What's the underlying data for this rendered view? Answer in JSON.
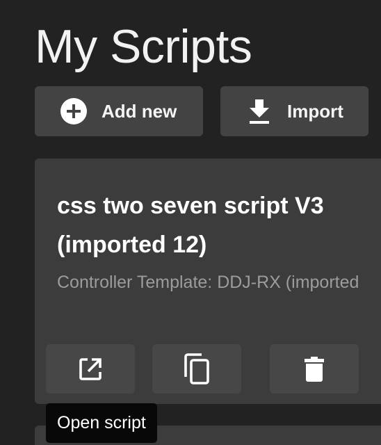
{
  "header": {
    "title": "My Scripts"
  },
  "toolbar": {
    "add_label": "Add new",
    "add_icon": "add-circle-icon",
    "import_label": "Import",
    "import_icon": "download-icon"
  },
  "scripts": [
    {
      "title": "css two seven script V3 (imported 12)",
      "subtitle": "Controller Template: DDJ-RX (imported",
      "actions": [
        {
          "icon": "open-in-new-icon",
          "tooltip": "Open script"
        },
        {
          "icon": "copy-icon"
        },
        {
          "icon": "trash-icon"
        }
      ]
    }
  ],
  "tooltip": {
    "text": "Open script"
  },
  "colors": {
    "background": "#222222",
    "button": "#434343",
    "card": "#3c3c3c",
    "action_button": "#474747",
    "subtitle": "#9c9c9c",
    "tooltip": "#080808"
  }
}
